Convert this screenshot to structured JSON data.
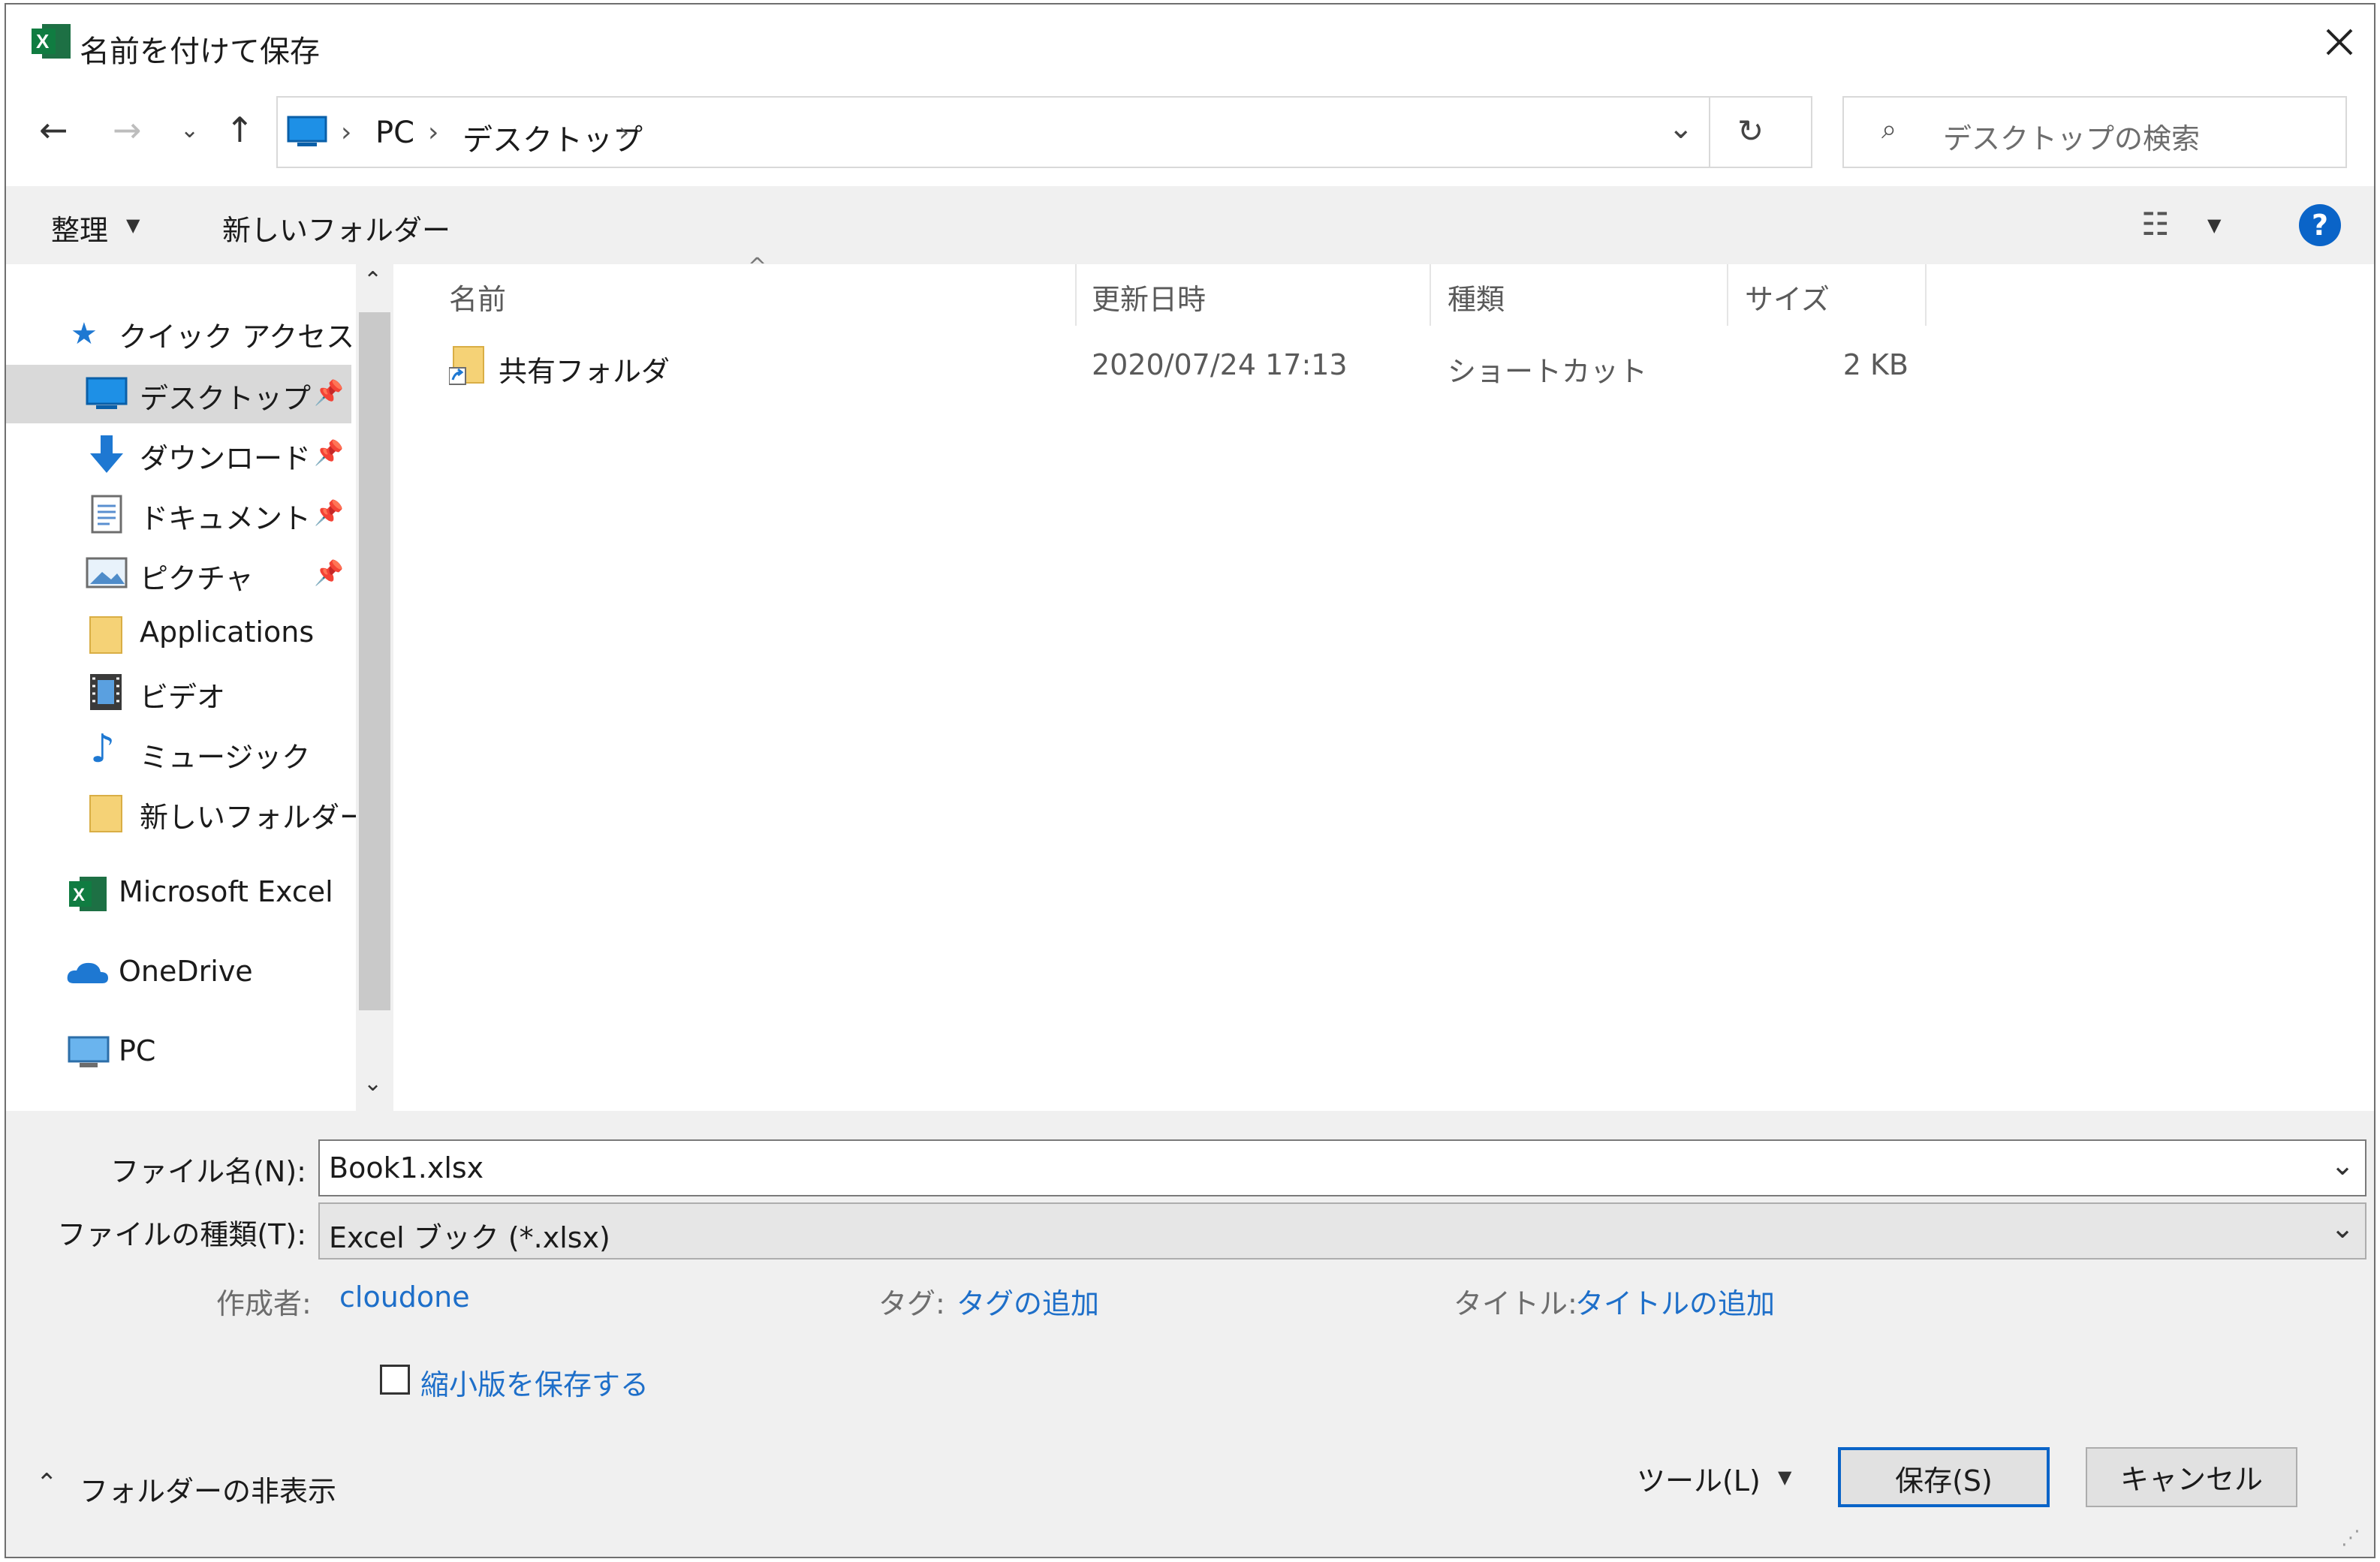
{
  "window": {
    "title": "名前を付けて保存",
    "app_icon": "excel-icon"
  },
  "address_bar": {
    "breadcrumbs": [
      "PC",
      "デスクトップ"
    ]
  },
  "search": {
    "placeholder": "デスクトップの検索"
  },
  "toolbar": {
    "organize": "整理",
    "new_folder": "新しいフォルダー"
  },
  "sidebar": {
    "quick_access": "クイック アクセス",
    "items": [
      {
        "label": "デスクトップ",
        "icon": "desktop-icon",
        "pinned": true,
        "selected": true
      },
      {
        "label": "ダウンロード",
        "icon": "download-icon",
        "pinned": true
      },
      {
        "label": "ドキュメント",
        "icon": "document-icon",
        "pinned": true
      },
      {
        "label": "ピクチャ",
        "icon": "picture-icon",
        "pinned": true
      },
      {
        "label": "Applications",
        "icon": "folder-icon"
      },
      {
        "label": "ビデオ",
        "icon": "video-icon"
      },
      {
        "label": "ミュージック",
        "icon": "music-icon"
      },
      {
        "label": "新しいフォルダー",
        "icon": "folder-icon"
      }
    ],
    "roots": [
      {
        "label": "Microsoft Excel",
        "icon": "excel-icon"
      },
      {
        "label": "OneDrive",
        "icon": "onedrive-icon"
      },
      {
        "label": "PC",
        "icon": "pc-icon"
      }
    ]
  },
  "file_list": {
    "columns": [
      "名前",
      "更新日時",
      "種類",
      "サイズ"
    ],
    "rows": [
      {
        "name": "共有フォルダ",
        "date": "2020/07/24 17:13",
        "type": "ショートカット",
        "size": "2 KB",
        "icon": "shortcut-folder-icon"
      }
    ]
  },
  "form": {
    "filename_label": "ファイル名(N):",
    "filename_value": "Book1.xlsx",
    "filetype_label": "ファイルの種類(T):",
    "filetype_value": "Excel ブック (*.xlsx)"
  },
  "metadata": {
    "author_label": "作成者:",
    "author_value": "cloudone",
    "tags_label": "タグ:",
    "tags_value": "タグの追加",
    "title_label": "タイトル:",
    "title_value": "タイトルの追加"
  },
  "thumbnail": {
    "label": "縮小版を保存する",
    "checked": false
  },
  "footer": {
    "hide_folders": "フォルダーの非表示",
    "tools": "ツール(L)",
    "save": "保存(S)",
    "cancel": "キャンセル"
  },
  "colors": {
    "accent": "#0a64c8",
    "link": "#1e6fc9",
    "excel_green": "#1d7044",
    "folder": "#f5d276"
  }
}
